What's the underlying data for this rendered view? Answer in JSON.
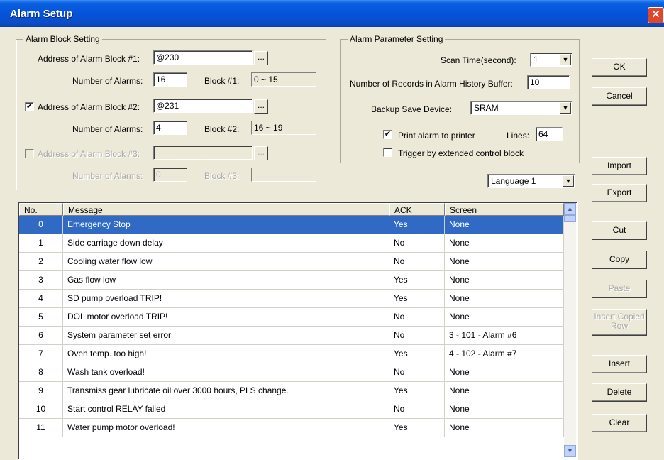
{
  "window": {
    "title": "Alarm Setup",
    "close_glyph": "✕"
  },
  "alarm_block": {
    "legend": "Alarm Block Setting",
    "block1": {
      "address_label": "Address of Alarm Block #1:",
      "address": "@230",
      "count_label": "Number of Alarms:",
      "count": "16",
      "range_label": "Block #1:",
      "range": "0 ~ 15"
    },
    "block2": {
      "checked": true,
      "address_label": "Address of Alarm Block #2:",
      "address": "@231",
      "count_label": "Number of Alarms:",
      "count": "4",
      "range_label": "Block #2:",
      "range": "16 ~ 19"
    },
    "block3": {
      "checked": false,
      "address_label": "Address of Alarm Block #3:",
      "address": "",
      "count_label": "Number of Alarms:",
      "count": "0",
      "range_label": "Block #3:",
      "range": ""
    },
    "browse_label": "..."
  },
  "alarm_param": {
    "legend": "Alarm Parameter Setting",
    "scan_time_label": "Scan Time(second):",
    "scan_time": "1",
    "records_label": "Number of Records in Alarm History Buffer:",
    "records": "10",
    "backup_label": "Backup Save Device:",
    "backup": "SRAM",
    "print_label": "Print alarm to printer",
    "print_checked": true,
    "lines_label": "Lines:",
    "lines": "64",
    "trigger_label": "Trigger by extended control block",
    "trigger_checked": false
  },
  "language": "Language 1",
  "buttons": {
    "ok": "OK",
    "cancel": "Cancel",
    "import": "Import",
    "export": "Export",
    "cut": "Cut",
    "copy": "Copy",
    "paste": "Paste",
    "insert_copied": "Insert Copied Row",
    "insert": "Insert",
    "delete": "Delete",
    "clear": "Clear"
  },
  "table": {
    "headers": [
      "No.",
      "Message",
      "ACK",
      "Screen"
    ],
    "rows": [
      {
        "no": "0",
        "message": "Emergency Stop",
        "ack": "Yes",
        "screen": "None"
      },
      {
        "no": "1",
        "message": "Side carriage down delay",
        "ack": "No",
        "screen": "None"
      },
      {
        "no": "2",
        "message": "Cooling water flow low",
        "ack": "No",
        "screen": "None"
      },
      {
        "no": "3",
        "message": "Gas flow low",
        "ack": "Yes",
        "screen": "None"
      },
      {
        "no": "4",
        "message": "SD pump overload TRIP!",
        "ack": "Yes",
        "screen": "None"
      },
      {
        "no": "5",
        "message": "DOL motor overload TRIP!",
        "ack": "No",
        "screen": "None"
      },
      {
        "no": "6",
        "message": "System parameter set error",
        "ack": "No",
        "screen": "3 - 101 - Alarm #6"
      },
      {
        "no": "7",
        "message": "Oven temp. too high!",
        "ack": "Yes",
        "screen": "4 - 102 - Alarm #7"
      },
      {
        "no": "8",
        "message": "Wash tank overload!",
        "ack": "No",
        "screen": "None"
      },
      {
        "no": "9",
        "message": "Transmiss gear lubricate oil over 3000 hours, PLS change.",
        "ack": "Yes",
        "screen": "None"
      },
      {
        "no": "10",
        "message": "Start control RELAY failed",
        "ack": "No",
        "screen": "None"
      },
      {
        "no": "11",
        "message": "Water pump motor overload!",
        "ack": "Yes",
        "screen": "None"
      }
    ],
    "selected_row": "0"
  }
}
